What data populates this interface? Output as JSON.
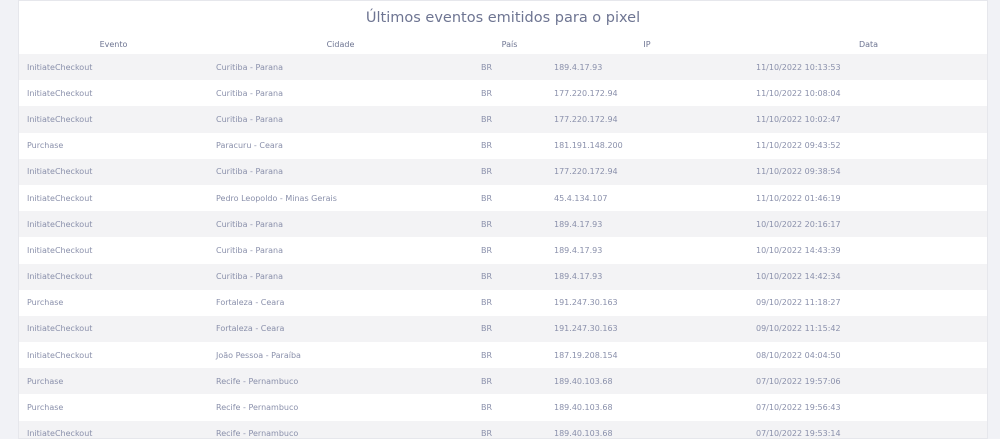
{
  "panel": {
    "title": "Últimos eventos emitidos para o pixel"
  },
  "table": {
    "columns": [
      "Evento",
      "Cidade",
      "País",
      "IP",
      "Data"
    ],
    "rows": [
      [
        "InitiateCheckout",
        "Curitiba - Parana",
        "BR",
        "189.4.17.93",
        "11/10/2022 10:13:53"
      ],
      [
        "InitiateCheckout",
        "Curitiba - Parana",
        "BR",
        "177.220.172.94",
        "11/10/2022 10:08:04"
      ],
      [
        "InitiateCheckout",
        "Curitiba - Parana",
        "BR",
        "177.220.172.94",
        "11/10/2022 10:02:47"
      ],
      [
        "Purchase",
        "Paracuru - Ceara",
        "BR",
        "181.191.148.200",
        "11/10/2022 09:43:52"
      ],
      [
        "InitiateCheckout",
        "Curitiba - Parana",
        "BR",
        "177.220.172.94",
        "11/10/2022 09:38:54"
      ],
      [
        "InitiateCheckout",
        "Pedro Leopoldo - Minas Gerais",
        "BR",
        "45.4.134.107",
        "11/10/2022 01:46:19"
      ],
      [
        "InitiateCheckout",
        "Curitiba - Parana",
        "BR",
        "189.4.17.93",
        "10/10/2022 20:16:17"
      ],
      [
        "InitiateCheckout",
        "Curitiba - Parana",
        "BR",
        "189.4.17.93",
        "10/10/2022 14:43:39"
      ],
      [
        "InitiateCheckout",
        "Curitiba - Parana",
        "BR",
        "189.4.17.93",
        "10/10/2022 14:42:34"
      ],
      [
        "Purchase",
        "Fortaleza - Ceara",
        "BR",
        "191.247.30.163",
        "09/10/2022 11:18:27"
      ],
      [
        "InitiateCheckout",
        "Fortaleza - Ceara",
        "BR",
        "191.247.30.163",
        "09/10/2022 11:15:42"
      ],
      [
        "InitiateCheckout",
        "João Pessoa - Paraíba",
        "BR",
        "187.19.208.154",
        "08/10/2022 04:04:50"
      ],
      [
        "Purchase",
        "Recife - Pernambuco",
        "BR",
        "189.40.103.68",
        "07/10/2022 19:57:06"
      ],
      [
        "Purchase",
        "Recife - Pernambuco",
        "BR",
        "189.40.103.68",
        "07/10/2022 19:56:43"
      ],
      [
        "InitiateCheckout",
        "Recife - Pernambuco",
        "BR",
        "189.40.103.68",
        "07/10/2022 19:53:14"
      ]
    ]
  }
}
